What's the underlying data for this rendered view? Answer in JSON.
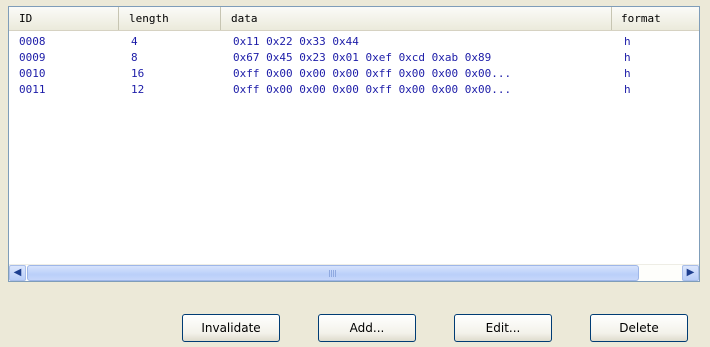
{
  "table": {
    "columns": {
      "id": "ID",
      "length": "length",
      "data": "data",
      "format": "format"
    },
    "rows": [
      {
        "id": "0008",
        "length": "4",
        "data": "0x11 0x22 0x33 0x44",
        "format": "h"
      },
      {
        "id": "0009",
        "length": "8",
        "data": "0x67 0x45 0x23 0x01 0xef 0xcd 0xab 0x89",
        "format": "h"
      },
      {
        "id": "0010",
        "length": "16",
        "data": "0xff 0x00 0x00 0x00 0xff 0x00 0x00 0x00...",
        "format": "h"
      },
      {
        "id": "0011",
        "length": "12",
        "data": "0xff 0x00 0x00 0x00 0xff 0x00 0x00 0x00...",
        "format": "h"
      }
    ]
  },
  "scrollbar": {
    "left_icon": "arrow-left-icon",
    "right_icon": "arrow-right-icon",
    "grip_icon": "scroll-grip-icon"
  },
  "buttons": {
    "invalidate": "Invalidate",
    "add": "Add...",
    "edit": "Edit...",
    "delete": "Delete"
  },
  "colors": {
    "row_text": "#1c1ca8",
    "window_bg": "#ece9d8",
    "border": "#7f9db9"
  }
}
